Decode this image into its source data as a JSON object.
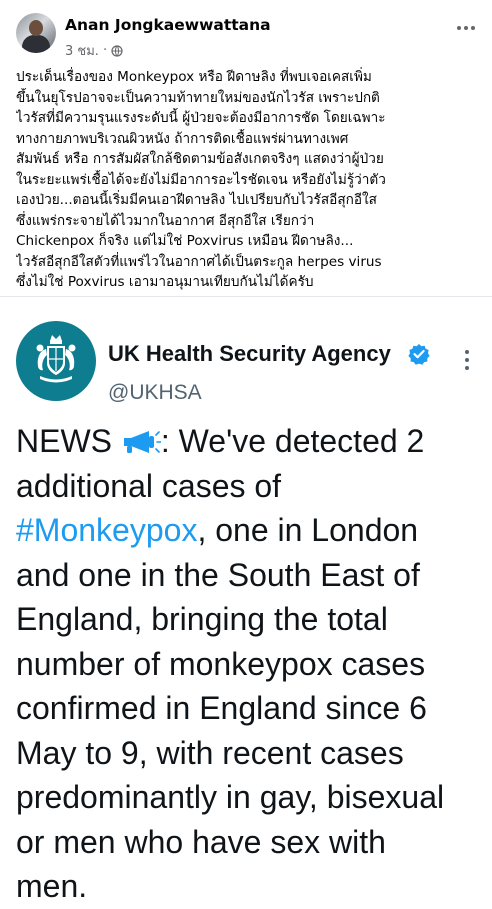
{
  "post": {
    "author": "Anan Jongkaewwattana",
    "time": "3 ชม.",
    "separator": "·",
    "privacy_icon": "globe-icon",
    "more_icon": "more-horizontal-icon",
    "lines": [
      "ประเด็นเรื่องของ Monkeypox หรือ ฝีดาษลิง ที่พบเจอเคสเพิ่ม",
      "ขึ้นในยุโรปอาจจะเป็นความท้าทายใหม่ของนักไวรัส เพราะปกติ",
      "ไวรัสที่มีความรุนแรงระดับนี้ ผู้ป่วยจะต้องมีอาการชัด โดยเฉพาะ",
      "ทางกายภาพบริเวณผิวหนัง ถ้าการติดเชื้อแพร่ผ่านทางเพศ",
      "สัมพันธ์ หรือ การสัมผัสใกล้ชิดตามข้อสังเกตจริงๆ แสดงว่าผู้ป่วย",
      "ในระยะแพร่เชื้อได้จะยังไม่มีอาการอะไรชัดเจน หรือยังไม่รู้ว่าตัว",
      "เองป่วย...ตอนนี้เริ่มมีคนเอาฝีดาษลิง ไปเปรียบกับไวรัสอีสุกอีใส",
      "ซึ่งแพร่กระจายได้ไวมากในอากาศ อีสุกอีใส เรียกว่า",
      "Chickenpox ก็จริง แต่ไม่ใช่ Poxvirus เหมือน ฝีดาษลิง...",
      "ไวรัสอีสุกอีใสตัวที่แพร่ไวในอากาศได้เป็นตระกูล herpes virus",
      "ซึ่งไม่ใช่ Poxvirus  เอามาอนุมานเทียบกันไม่ได้ครับ"
    ]
  },
  "tweet": {
    "name": "UK Health Security Agency",
    "handle": "@UKHSA",
    "verified_icon": "verified-badge-icon",
    "more_icon": "more-vertical-icon",
    "logo_icon": "royal-crest-icon",
    "accent_color": "#1d9bf0",
    "lines": [
      {
        "before": "NEWS ",
        "icon": "megaphone-icon",
        "after": ": We've detected 2"
      },
      {
        "text": "additional cases of"
      },
      {
        "hashtag": "#Monkeypox",
        "after": ", one in London"
      },
      {
        "text": "and one in the South East of"
      },
      {
        "text": "England, bringing the total"
      },
      {
        "text": "number of monkeypox cases"
      },
      {
        "text": "confirmed in England since 6"
      },
      {
        "text": "May to 9, with recent cases"
      },
      {
        "text": "predominantly in gay, bisexual"
      },
      {
        "text": "or men who have sex with"
      },
      {
        "text": "men."
      }
    ]
  }
}
